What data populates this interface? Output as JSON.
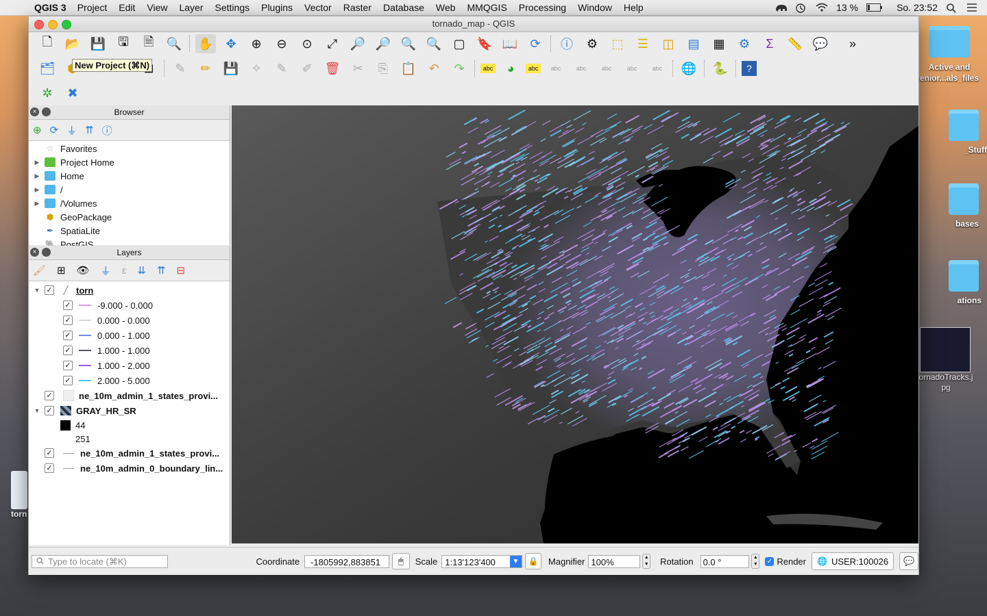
{
  "menubar": {
    "app": "QGIS 3",
    "items": [
      "Project",
      "Edit",
      "View",
      "Layer",
      "Settings",
      "Plugins",
      "Vector",
      "Raster",
      "Database",
      "Web",
      "MMQGIS",
      "Processing",
      "Window",
      "Help"
    ],
    "battery": "13 %",
    "clock": "So. 23:52"
  },
  "desktop": {
    "folder1_label": "Active and enior...als_files",
    "folder2_label": "_Stuff",
    "folder3_label": "bases",
    "folder4_label": "ations",
    "image_label": "ornadoTracks.j pg",
    "left_label": "torn"
  },
  "window": {
    "title": "tornado_map - QGIS"
  },
  "tooltip": "New Project (⌘N)",
  "browser": {
    "title": "Browser",
    "items": [
      {
        "label": "Favorites",
        "icon": "star-icon"
      },
      {
        "label": "Project Home",
        "icon": "project-home-icon"
      },
      {
        "label": "Home",
        "icon": "folder-icon"
      },
      {
        "label": "/",
        "icon": "folder-icon"
      },
      {
        "label": "/Volumes",
        "icon": "folder-icon"
      },
      {
        "label": "GeoPackage",
        "icon": "geopackage-icon"
      },
      {
        "label": "SpatiaLite",
        "icon": "spatialite-icon"
      },
      {
        "label": "PostGIS",
        "icon": "postgis-icon"
      }
    ]
  },
  "layers": {
    "title": "Layers",
    "torn": {
      "name": "torn",
      "classes": [
        {
          "label": "-9.000 - 0.000",
          "color": "#d59ee8"
        },
        {
          "label": "0.000 - 0.000",
          "color": "#d9d9d9"
        },
        {
          "label": "0.000 - 1.000",
          "color": "#6f8ee0"
        },
        {
          "label": "1.000 - 1.000",
          "color": "#555566"
        },
        {
          "label": "1.000 - 2.000",
          "color": "#9a5be0"
        },
        {
          "label": "2.000 - 5.000",
          "color": "#4cc3ea"
        }
      ]
    },
    "states_poly": "ne_10m_admin_1_states_provi...",
    "raster": {
      "name": "GRAY_HR_SR",
      "min": "44",
      "max": "251"
    },
    "states_lines": "ne_10m_admin_1_states_provi...",
    "boundary": "ne_10m_admin_0_boundary_lin..."
  },
  "status": {
    "locate_placeholder": "Type to locate (⌘K)",
    "coordinate_label": "Coordinate",
    "coordinate": "-1805992,883851",
    "scale_label": "Scale",
    "scale": "1:13'123'400",
    "magnifier_label": "Magnifier",
    "magnifier": "100%",
    "rotation_label": "Rotation",
    "rotation": "0.0 °",
    "render_label": "Render",
    "crs": "USER:100026"
  },
  "colors": {
    "accent": "#2f7ef0",
    "map_bg": "#000000",
    "track_purple": "#c79ef0",
    "track_cyan": "#5cc8f0"
  }
}
